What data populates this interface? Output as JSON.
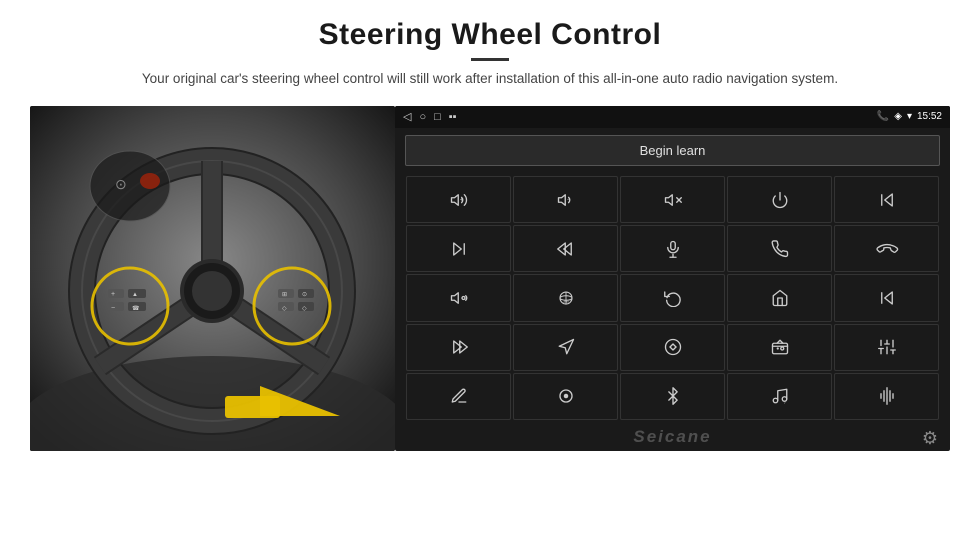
{
  "header": {
    "title": "Steering Wheel Control",
    "subtitle": "Your original car's steering wheel control will still work after installation of this all-in-one auto radio navigation system."
  },
  "status_bar": {
    "back_icon": "◁",
    "home_icon": "○",
    "recent_icon": "□",
    "media_icon": "▪▪",
    "phone_icon": "📞",
    "location_icon": "◈",
    "wifi_icon": "▾",
    "time": "15:52"
  },
  "begin_learn": {
    "label": "Begin learn"
  },
  "grid_buttons": [
    {
      "id": "vol-up",
      "icon": "vol-up",
      "label": "Volume Up"
    },
    {
      "id": "vol-down",
      "icon": "vol-down",
      "label": "Volume Down"
    },
    {
      "id": "vol-mute",
      "icon": "vol-mute",
      "label": "Mute"
    },
    {
      "id": "power",
      "icon": "power",
      "label": "Power"
    },
    {
      "id": "prev-track",
      "icon": "prev-track",
      "label": "Previous Track"
    },
    {
      "id": "skip-fwd",
      "icon": "skip-fwd",
      "label": "Skip Forward"
    },
    {
      "id": "seek-bk",
      "icon": "seek-bk",
      "label": "Seek Back"
    },
    {
      "id": "mic",
      "icon": "mic",
      "label": "Microphone"
    },
    {
      "id": "phone",
      "icon": "phone",
      "label": "Phone"
    },
    {
      "id": "hang-up",
      "icon": "hang-up",
      "label": "Hang Up"
    },
    {
      "id": "horn",
      "icon": "horn",
      "label": "Horn"
    },
    {
      "id": "360view",
      "icon": "360view",
      "label": "360 View"
    },
    {
      "id": "undo",
      "icon": "undo",
      "label": "Undo"
    },
    {
      "id": "home",
      "icon": "home",
      "label": "Home"
    },
    {
      "id": "skip-back2",
      "icon": "skip-back2",
      "label": "Skip Back"
    },
    {
      "id": "fast-fwd",
      "icon": "fast-fwd",
      "label": "Fast Forward"
    },
    {
      "id": "navigate",
      "icon": "navigate",
      "label": "Navigate"
    },
    {
      "id": "swap",
      "icon": "swap",
      "label": "Swap"
    },
    {
      "id": "radio",
      "icon": "radio",
      "label": "Radio"
    },
    {
      "id": "equalizer",
      "icon": "equalizer",
      "label": "Equalizer"
    },
    {
      "id": "pencil",
      "icon": "pencil",
      "label": "Pencil"
    },
    {
      "id": "360btn",
      "icon": "360btn",
      "label": "360"
    },
    {
      "id": "bluetooth",
      "icon": "bluetooth",
      "label": "Bluetooth"
    },
    {
      "id": "music",
      "icon": "music",
      "label": "Music"
    },
    {
      "id": "voice-eq",
      "icon": "voice-eq",
      "label": "Voice EQ"
    }
  ],
  "watermark": "Seicane",
  "settings_icon": "⚙"
}
